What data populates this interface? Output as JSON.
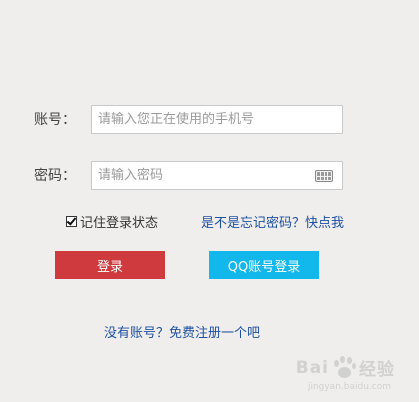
{
  "form": {
    "account_label": "账号：",
    "account_placeholder": "请输入您正在使用的手机号",
    "password_label": "密码：",
    "password_placeholder": "请输入密码",
    "keyboard_icon": "keyboard-icon",
    "remember_checked": true,
    "remember_label": "记住登录状态",
    "forgot_link": "是不是忘记密码？快点我",
    "login_button": "登录",
    "qq_login_button": "QQ账号登录",
    "register_link": "没有账号？免费注册一个吧"
  },
  "watermark": {
    "brand_left": "Bai",
    "brand_right": "经验",
    "domain": "jingyan.baidu.com"
  },
  "colors": {
    "background": "#efeeec",
    "login_button": "#cf3a3e",
    "qq_button": "#12b7ec",
    "link": "#1e50a2"
  }
}
